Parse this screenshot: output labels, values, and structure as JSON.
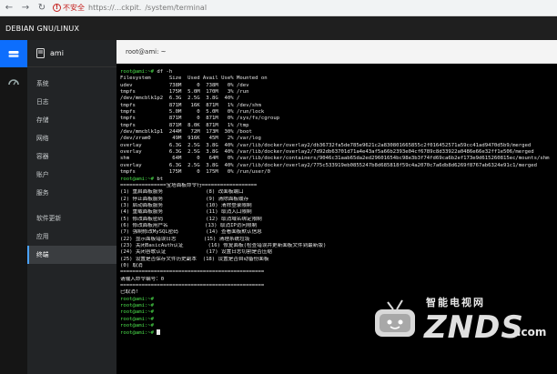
{
  "browser": {
    "insecure_label": "不安全",
    "url_host": "https://...ckpit.",
    "url_path": "/system/terminal"
  },
  "app": {
    "title": "DEBIAN GNU/LINUX"
  },
  "host": {
    "name": "ami"
  },
  "nav": {
    "items": [
      {
        "label": "系统"
      },
      {
        "label": "日志"
      },
      {
        "label": "存储"
      },
      {
        "label": "网络"
      },
      {
        "label": "容器"
      },
      {
        "label": "账户"
      },
      {
        "label": "服务"
      },
      {
        "label": "软件更新"
      },
      {
        "label": "应用"
      },
      {
        "label": "终端"
      }
    ]
  },
  "terminal": {
    "header": "root@ami: ~",
    "lines": [
      {
        "prompt": "root@ami:~# ",
        "text": "df -h"
      },
      {
        "prompt": "",
        "text": "Filesystem      Size  Used Avail Use% Mounted on"
      },
      {
        "prompt": "",
        "text": "udev            738M     0  738M   0% /dev"
      },
      {
        "prompt": "",
        "text": "tmpfs           175M  5.0M  170M   3% /run"
      },
      {
        "prompt": "",
        "text": "/dev/mmcblk1p2  6.3G  2.5G  3.8G  40% /"
      },
      {
        "prompt": "",
        "text": "tmpfs           871M   16K  871M   1% /dev/shm"
      },
      {
        "prompt": "",
        "text": "tmpfs           5.0M     0  5.0M   0% /run/lock"
      },
      {
        "prompt": "",
        "text": "tmpfs           871M     0  871M   0% /sys/fs/cgroup"
      },
      {
        "prompt": "",
        "text": "tmpfs           871M  8.0K  871M   1% /tmp"
      },
      {
        "prompt": "",
        "text": "/dev/mmcblk1p1  244M   72M  173M  30% /boot"
      },
      {
        "prompt": "",
        "text": "/dev/zram0       49M  916K   45M   2% /var/log"
      },
      {
        "prompt": "",
        "text": "overlay         6.3G  2.5G  3.8G  40% /var/lib/docker/overlay2/db36732fa5de785e9621c2a830801665855c2f016452571a59cc41ad9470d5b9/merged"
      },
      {
        "prompt": "",
        "text": "overlay         6.3G  2.5G  3.8G  40% /var/lib/docker/overlay2/7d92db63701d71a4e43af5a66b2393e04cf6789c8d33922a0486e66e32ff1e506/merged"
      },
      {
        "prompt": "",
        "text": "shm              64M     0   64M   0% /var/lib/docker/containers/9046c31aab65da2ed29601654bc98e3b3f74fd69ca6b2ef173e9d615260815ec/mounts/shm"
      },
      {
        "prompt": "",
        "text": "overlay         6.3G  2.5G  3.8G  40% /var/lib/docker/overlay2/775c533919eb0855247b8d685818f59c4a2070c7a6db8d6269f8767ab6324e91c1/merged"
      },
      {
        "prompt": "",
        "text": "tmpfs           175M     0  175M   0% /run/user/0"
      },
      {
        "prompt": "root@ami:~# ",
        "text": "bt"
      },
      {
        "prompt": "",
        "text": "===============宝塔面板命令行=================="
      },
      {
        "prompt": "",
        "text": "(1) 重启面板服务              (8) 改面板端口"
      },
      {
        "prompt": "",
        "text": "(2) 停止面板服务              (9) 清除面板缓存"
      },
      {
        "prompt": "",
        "text": "(3) 启动面板服务              (10) 清除登录限制"
      },
      {
        "prompt": "",
        "text": "(4) 重载面板服务              (11) 取消入口限制"
      },
      {
        "prompt": "",
        "text": "(5) 修改面板密码              (12) 取消域名绑定限制"
      },
      {
        "prompt": "",
        "text": "(6) 修改面板用户名            (13) 取消IP访问限制"
      },
      {
        "prompt": "",
        "text": "(7) 强制修改MySQL密码         (14) 查看面板默认信息"
      },
      {
        "prompt": "",
        "text": "(22) 显示面板错误日志         (15) 清理系统垃圾"
      },
      {
        "prompt": "",
        "text": "(23) 关闭BasicAuth认证        (16) 修复面板(检查错误并更新面板文件到最新版)"
      },
      {
        "prompt": "",
        "text": "(24) 关闭谷歌认证             (17) 设置日志切割是否压缩"
      },
      {
        "prompt": "",
        "text": "(25) 设置是否保存文件历史副本  (18) 设置是否自动备份面板"
      },
      {
        "prompt": "",
        "text": "(0) 取消"
      },
      {
        "prompt": "",
        "text": "==============================================="
      },
      {
        "prompt": "",
        "text": "请输入命令编号：0"
      },
      {
        "prompt": "",
        "text": "==============================================="
      },
      {
        "prompt": "",
        "text": "已取消!"
      },
      {
        "prompt": "root@ami:~# ",
        "text": ""
      },
      {
        "prompt": "root@ami:~# ",
        "text": ""
      },
      {
        "prompt": "root@ami:~# ",
        "text": ""
      },
      {
        "prompt": "root@ami:~# ",
        "text": ""
      },
      {
        "prompt": "root@ami:~# ",
        "text": ""
      },
      {
        "prompt": "root@ami:~# ",
        "text": "",
        "cursor": true
      }
    ]
  },
  "watermark": {
    "cn": "智能电视网",
    "en": "ZNDS",
    "suffix": ".com"
  }
}
